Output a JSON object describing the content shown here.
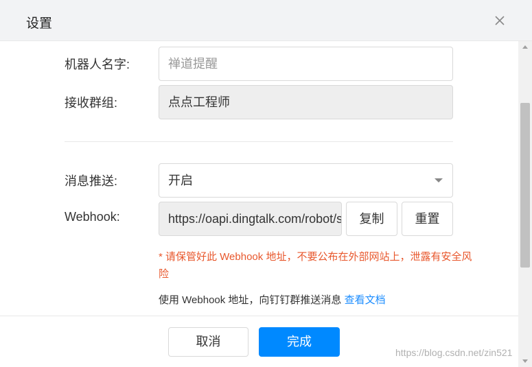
{
  "dialog": {
    "title": "设置",
    "close_icon": "close-icon"
  },
  "form": {
    "robot_name": {
      "label": "机器人名字:",
      "placeholder": "禅道提醒",
      "value": ""
    },
    "group": {
      "label": "接收群组:",
      "value": "点点工程师"
    },
    "push": {
      "label": "消息推送:",
      "selected": "开启"
    },
    "webhook": {
      "label": "Webhook:",
      "value": "https://oapi.dingtalk.com/robot/send?access_token=",
      "copy_label": "复制",
      "reset_label": "重置"
    },
    "warning": "* 请保管好此 Webhook 地址，不要公布在外部网站上，泄露有安全风险",
    "hint": {
      "text": "使用 Webhook 地址，向钉钉群推送消息",
      "link": "查看文档"
    }
  },
  "footer": {
    "cancel_label": "取消",
    "done_label": "完成"
  },
  "watermark": "https://blog.csdn.net/zin521",
  "colors": {
    "primary": "#0089ff",
    "warning": "#e8572c",
    "link": "#1a8cff",
    "disabled_bg": "#eeeeee"
  }
}
